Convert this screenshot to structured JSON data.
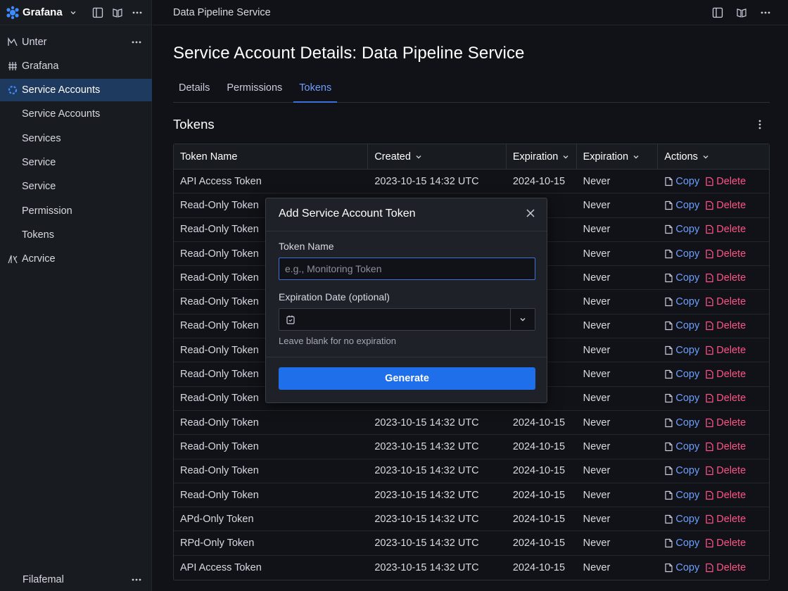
{
  "app": {
    "name": "Grafana"
  },
  "sidebar": {
    "items": [
      {
        "label": "Unter"
      },
      {
        "label": "Grafana"
      },
      {
        "label": "Service Accounts"
      },
      {
        "label": "Service Accounts"
      },
      {
        "label": "Services"
      },
      {
        "label": "Service"
      },
      {
        "label": "Service"
      },
      {
        "label": "Permission"
      },
      {
        "label": "Tokens"
      },
      {
        "label": "Acrvice"
      }
    ],
    "bottom_label": "Filafemal"
  },
  "topbar": {
    "breadcrumb": "Data Pipeline Service"
  },
  "page": {
    "title": "Service Account Details: Data Pipeline Service",
    "tabs": [
      "Details",
      "Permissions",
      "Tokens"
    ],
    "active_tab": "Tokens",
    "section_title": "Tokens"
  },
  "table": {
    "columns": [
      "Token Name",
      "Created",
      "Expiration",
      "Expiration",
      "Actions"
    ],
    "copy_label": "Copy",
    "delete_label": "Delete",
    "rows": [
      [
        "API Access Token",
        "2023-10-15 14:32 UTC",
        "2024-10-15",
        "Never"
      ],
      [
        "Read-Only Token",
        "",
        "-15",
        "Never"
      ],
      [
        "Read-Only Token",
        "",
        "-15",
        "Never"
      ],
      [
        "Read-Only Token",
        "",
        "-15",
        "Never"
      ],
      [
        "Read-Only Token",
        "",
        "-15",
        "Never"
      ],
      [
        "Read-Only Token",
        "",
        "-15",
        "Never"
      ],
      [
        "Read-Only Token",
        "",
        "-15",
        "Never"
      ],
      [
        "Read-Only Token",
        "",
        "-15",
        "Never"
      ],
      [
        "Read-Only Token",
        "",
        "-15",
        "Never"
      ],
      [
        "Read-Only Token",
        "",
        "-15",
        "Never"
      ],
      [
        "Read-Only Token",
        "2023-10-15 14:32 UTC",
        "2024-10-15",
        "Never"
      ],
      [
        "Read-Only Token",
        "2023-10-15 14:32 UTC",
        "2024-10-15",
        "Never"
      ],
      [
        "Read-Only Token",
        "2023-10-15 14:32 UTC",
        "2024-10-15",
        "Never"
      ],
      [
        "Read-Only Token",
        "2023-10-15 14:32 UTC",
        "2024-10-15",
        "Never"
      ],
      [
        "APd-Only Token",
        "2023-10-15 14:32 UTC",
        "2024-10-15",
        "Never"
      ],
      [
        "RPd-Only Token",
        "2023-10-15 14:32 UTC",
        "2024-10-15",
        "Never"
      ],
      [
        "API Access Token",
        "2023-10-15 14:32 UTC",
        "2024-10-15",
        "Never"
      ]
    ]
  },
  "modal": {
    "title": "Add Service Account Token",
    "token_name_label": "Token Name",
    "token_name_placeholder": "e.g., Monitoring Token",
    "expiration_label": "Expiration Date (optional)",
    "expiration_hint": "Leave blank for no expiration",
    "generate_label": "Generate"
  },
  "colors": {
    "accent": "#1f6feb",
    "link": "#6e9fff",
    "danger": "#ff5286",
    "active_nav": "#1f3a5f"
  }
}
